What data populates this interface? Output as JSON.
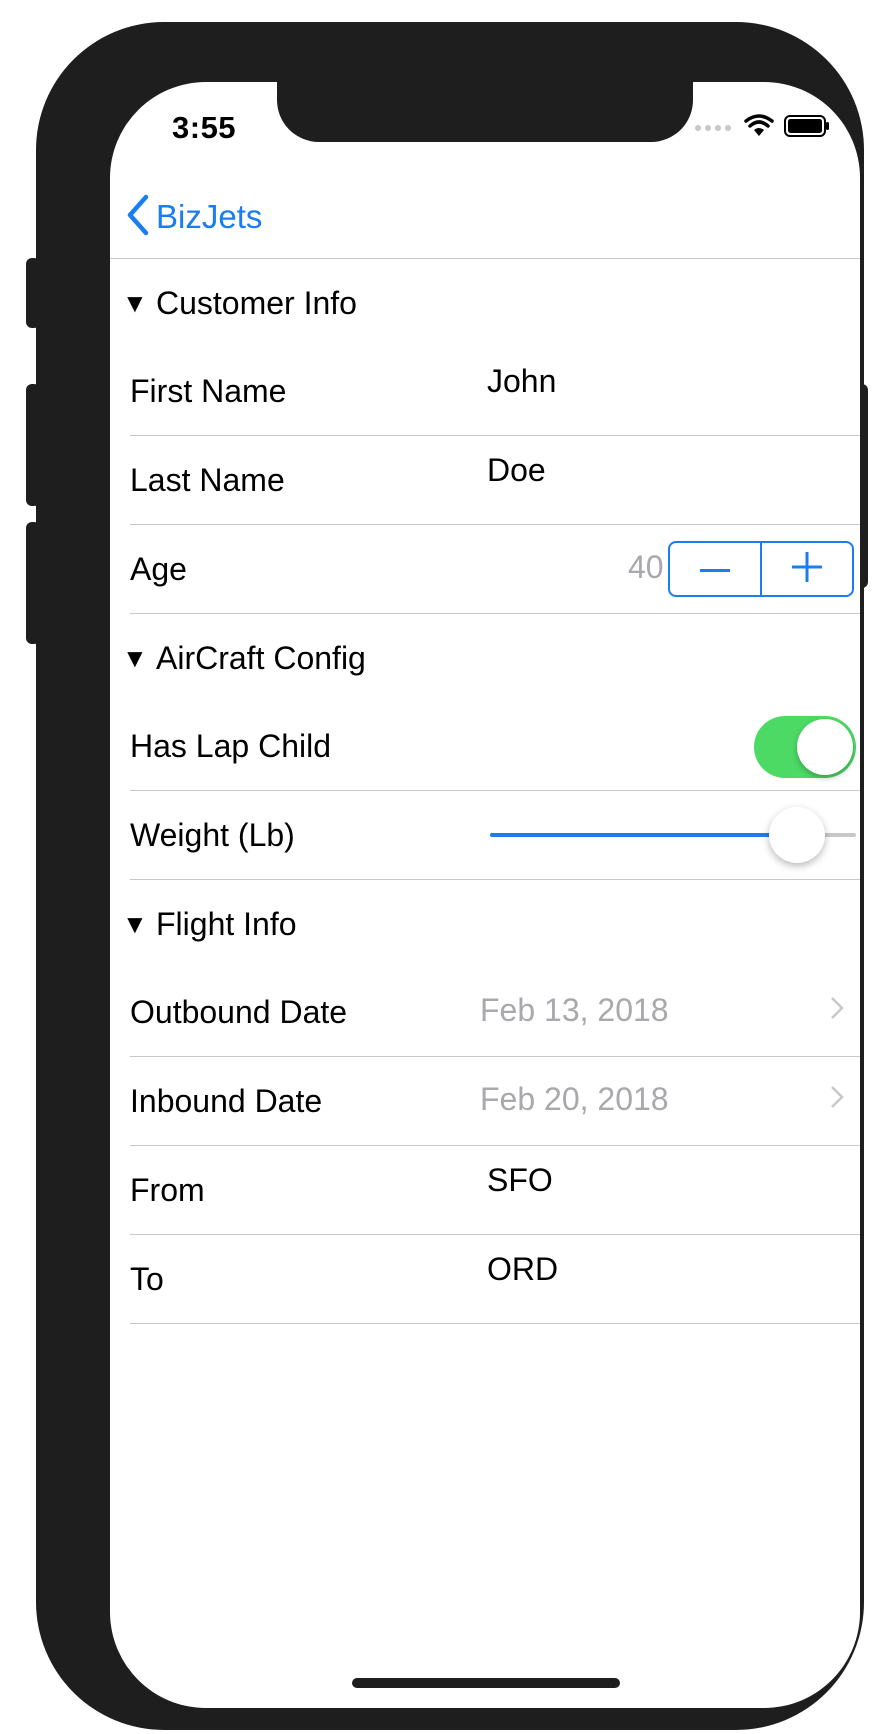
{
  "status_bar": {
    "time": "3:55"
  },
  "nav": {
    "back_label": "BizJets"
  },
  "sections": {
    "customer": {
      "title": "Customer Info",
      "first_name": {
        "label": "First Name",
        "value": "John"
      },
      "last_name": {
        "label": "Last Name",
        "value": "Doe"
      },
      "age": {
        "label": "Age",
        "value": "40"
      }
    },
    "aircraft": {
      "title": "AirCraft Config",
      "lap_child": {
        "label": "Has Lap Child",
        "on": true
      },
      "weight": {
        "label": "Weight (Lb)",
        "fraction": 0.9
      }
    },
    "flight": {
      "title": "Flight Info",
      "outbound": {
        "label": "Outbound Date",
        "value": "Feb 13, 2018"
      },
      "inbound": {
        "label": "Inbound Date",
        "value": "Feb 20, 2018"
      },
      "from": {
        "label": "From",
        "value": "SFO"
      },
      "to": {
        "label": "To",
        "value": "ORD"
      }
    }
  },
  "colors": {
    "accent": "#1a7df2",
    "toggle_on": "#4cd964",
    "separator": "#c8c7cc",
    "secondary_text": "#a8a8ad"
  },
  "icons": [
    "back-chevron-icon",
    "disclosure-triangle-icon",
    "minus-icon",
    "plus-icon",
    "chevron-right-icon",
    "wifi-icon",
    "battery-icon",
    "signal-icon"
  ]
}
